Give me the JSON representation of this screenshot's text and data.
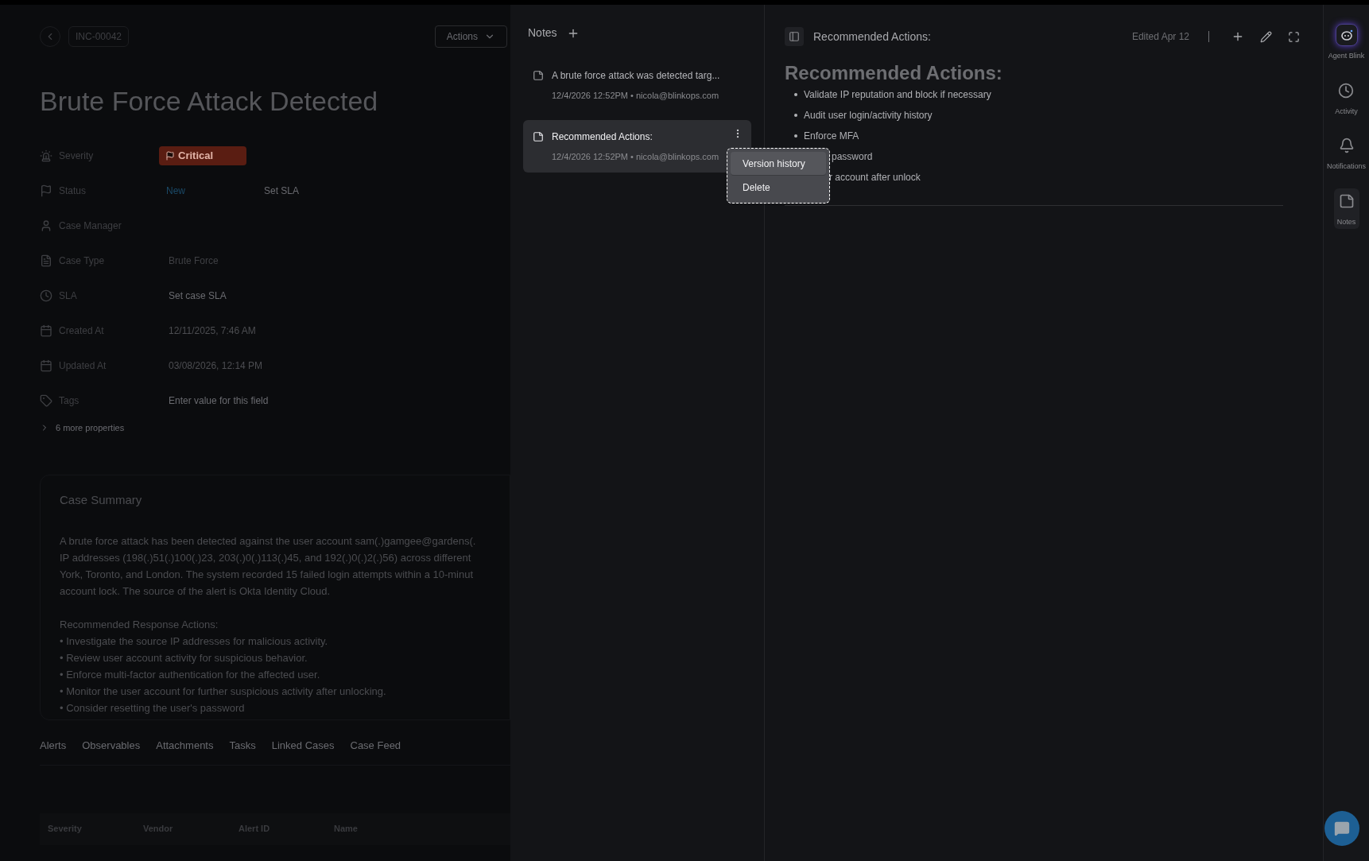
{
  "case": {
    "id": "INC-00042",
    "actions": "Actions",
    "title": "Brute Force Attack Detected",
    "properties": [
      {
        "kind": "severity",
        "label": "Severity",
        "value": "Critical"
      },
      {
        "kind": "status",
        "label": "Status",
        "value": "New",
        "extra": "Set SLA"
      },
      {
        "kind": "person",
        "label": "Case Manager"
      },
      {
        "kind": "type",
        "label": "Case Type",
        "value": "Brute Force"
      },
      {
        "kind": "sla",
        "label": "SLA",
        "placeholder": "Set case SLA"
      },
      {
        "kind": "date",
        "label": "Created At",
        "value": "12/11/2025, 7:46 AM"
      },
      {
        "kind": "date",
        "label": "Updated At",
        "value": "03/08/2026, 12:14 PM"
      },
      {
        "kind": "tags",
        "label": "Tags",
        "placeholder": "Enter value for this field"
      }
    ],
    "more": "6 more properties",
    "summary": {
      "title": "Case Summary",
      "lines": [
        "A brute force attack has been detected against the user account sam(.)gamgee@gardens(.",
        "IP addresses (198(.)51(.)100(.)23, 203(.)0(.)113(.)45, and 192(.)0(.)2(.)56) across different",
        "York, Toronto, and London. The system recorded 15 failed login attempts within a 10-minut",
        "account lock. The source of the alert is Okta Identity Cloud."
      ],
      "actions_title": "Recommended Response Actions:",
      "actions": [
        "• Investigate the source IP addresses for malicious activity.",
        "• Review user account activity for suspicious behavior.",
        "• Enforce multi-factor authentication for the affected user.",
        "• Monitor the user account for further suspicious activity after unlocking.",
        "• Consider resetting the user's password"
      ]
    },
    "tabs": [
      {
        "label": "Alerts",
        "selected": false
      },
      {
        "label": "Observables",
        "selected": false
      },
      {
        "label": "Attachments",
        "selected": false
      },
      {
        "label": "Tasks",
        "selected": false
      },
      {
        "label": "Linked Cases",
        "selected": false
      },
      {
        "label": "Case Feed",
        "selected": false
      }
    ],
    "table": {
      "columns": [
        "Severity",
        "Vendor",
        "Alert ID",
        "Name"
      ]
    }
  },
  "notes": {
    "title": "Notes",
    "items": [
      {
        "title": "A brute force attack was detected targ...",
        "meta": "12/4/2026 12:52PM • nicola@blinkops.com",
        "selected": false
      },
      {
        "title": "Recommended Actions:",
        "meta": "12/4/2026 12:52PM • nicola@blinkops.com",
        "selected": true
      }
    ],
    "menu": [
      "Version history",
      "Delete"
    ]
  },
  "editor": {
    "title": "Recommended Actions:",
    "edited": "Edited Apr 12",
    "heading": "Recommended Actions:",
    "bullets": [
      "Validate IP reputation and block if necessary",
      "Audit user login/activity history",
      "Enforce MFA"
    ],
    "covered_bullets": [
      "password",
      "r account after unlock"
    ]
  },
  "rail": [
    {
      "kind": "agent",
      "label": "Agent Blink",
      "selected": false
    },
    {
      "kind": "activity",
      "label": "Activity",
      "selected": false
    },
    {
      "kind": "bell",
      "label": "Notifications",
      "selected": false
    },
    {
      "kind": "note",
      "label": "Notes",
      "selected": true
    }
  ]
}
